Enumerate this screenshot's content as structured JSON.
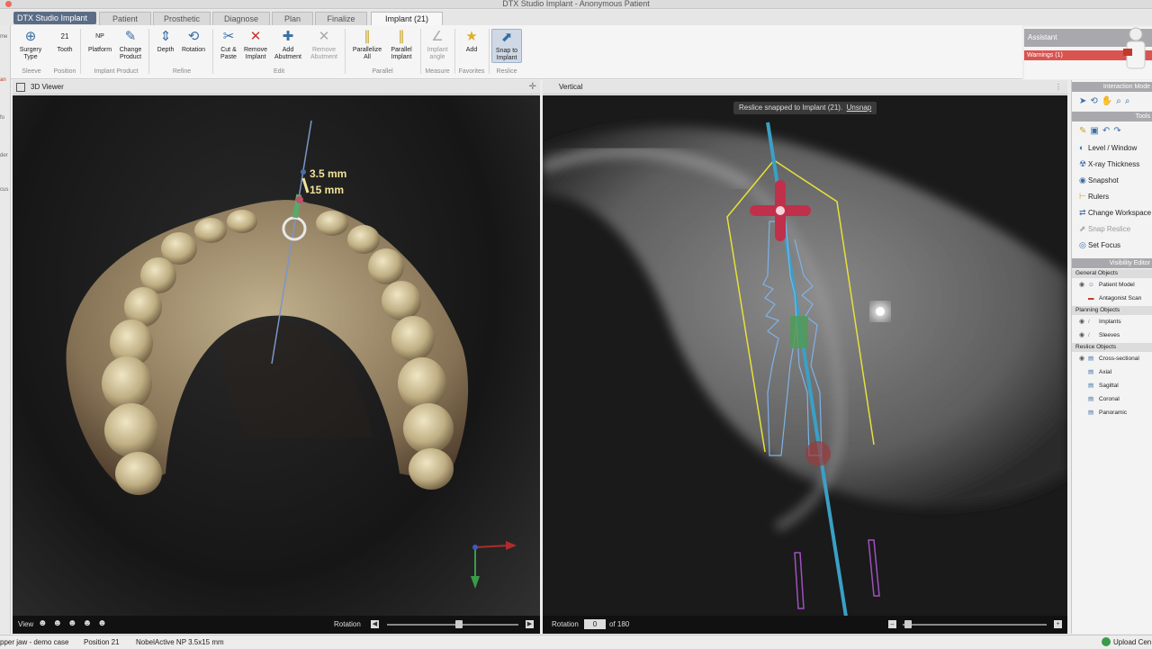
{
  "window": {
    "title": "DTX Studio Implant - Anonymous Patient"
  },
  "app_menu": {
    "label": "DTX Studio Implant ▼"
  },
  "tabs": [
    {
      "label": "Patient"
    },
    {
      "label": "Prosthetic"
    },
    {
      "label": "Diagnose"
    },
    {
      "label": "Plan"
    },
    {
      "label": "Finalize"
    },
    {
      "label": "Implant (21)"
    }
  ],
  "ribbon": {
    "buttons": [
      {
        "label": "Surgery Type",
        "icon": "drill-icon"
      },
      {
        "label": "21",
        "sub": "Tooth",
        "icon": "tooth-number"
      },
      {
        "label": "NP",
        "sub": "Platform",
        "icon": "platform-icon"
      },
      {
        "label": "Change Product",
        "icon": "change-product-icon"
      },
      {
        "label": "Depth",
        "icon": "depth-icon"
      },
      {
        "label": "Rotation",
        "icon": "rotation-icon"
      },
      {
        "label": "Cut & Paste",
        "icon": "cut-icon"
      },
      {
        "label": "Remove Implant",
        "icon": "remove-implant-icon"
      },
      {
        "label": "Add Abutment",
        "icon": "add-abutment-icon"
      },
      {
        "label": "Remove Abutment",
        "icon": "remove-abutment-icon"
      },
      {
        "label": "Parallelize All",
        "icon": "parallelize-all-icon"
      },
      {
        "label": "Parallel Implant",
        "icon": "parallel-implant-icon"
      },
      {
        "label": "Implant angle",
        "icon": "implant-angle-icon"
      },
      {
        "label": "Add",
        "icon": "star-icon"
      },
      {
        "label": "Snap to Implant",
        "icon": "snap-icon"
      }
    ],
    "groups": [
      {
        "label": "Sleeve"
      },
      {
        "label": "Position"
      },
      {
        "label": "Implant Product"
      },
      {
        "label": "Refine"
      },
      {
        "label": "Edit"
      },
      {
        "label": "Parallel"
      },
      {
        "label": "Measure"
      },
      {
        "label": "Favorites"
      },
      {
        "label": "Reslice"
      }
    ]
  },
  "assistant": {
    "title": "Assistant",
    "warnings": "Warnings (1)"
  },
  "left_strip": [
    "me",
    "an",
    "fo",
    "der",
    "cus"
  ],
  "viewer3d": {
    "title": "3D Viewer",
    "measure_diameter": "3.5 mm",
    "measure_length": "15 mm",
    "view_label": "View",
    "rotation_label": "Rotation",
    "rotation_value": 0.55
  },
  "vertical": {
    "title": "Vertical",
    "toast": "Reslice snapped to Implant (21).",
    "toast_link": "Unsnap",
    "rotation_label": "Rotation",
    "rotation_value": "0",
    "rotation_of": "of 180"
  },
  "sidebar": {
    "interaction_mode": "Interaction Mode",
    "tools_header": "Tools",
    "tools": [
      {
        "label": "Level / Window",
        "icon": "contrast-icon"
      },
      {
        "label": "X-ray Thickness",
        "icon": "xray-icon"
      },
      {
        "label": "Snapshot",
        "icon": "camera-icon"
      },
      {
        "label": "Rulers",
        "icon": "ruler-icon"
      },
      {
        "label": "Change Workspace",
        "icon": "workspace-icon"
      },
      {
        "label": "Snap Reslice",
        "icon": "snap-icon"
      },
      {
        "label": "Set Focus",
        "icon": "focus-icon"
      }
    ],
    "visibility_header": "Visibility Editor",
    "general_objects": "General Objects",
    "general_items": [
      "Patient Model",
      "Antagonist Scan"
    ],
    "planning_objects": "Planning Objects",
    "planning_items": [
      "Implants",
      "Sleeves"
    ],
    "reslice_objects": "Reslice Objects",
    "reslice_items": [
      "Cross-sectional",
      "Axial",
      "Sagittal",
      "Coronal",
      "Panoramic"
    ]
  },
  "status": {
    "jaw": "pper jaw - demo case",
    "position": "Position 21",
    "product": "NobelActive NP 3.5x15 mm",
    "upload": "Upload Cen"
  },
  "colors": {
    "accent": "#3a6ea5",
    "warning": "#d9534f",
    "implant_outline": "#7fb2e8",
    "reslice_box": "#e8e03a"
  }
}
